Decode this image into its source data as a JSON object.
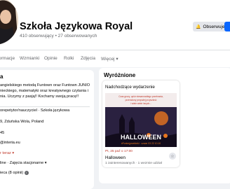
{
  "page": {
    "name": "Szkoła Językowa Royal",
    "followers": "410 obserwujący • 27 obserwowanych"
  },
  "actions": {
    "follow_label": "Obserwujesz"
  },
  "tabs": [
    "ormacje",
    "Wzmianki",
    "Opinie",
    "Rolki",
    "Zdjęcia",
    "Więcej"
  ],
  "intro": {
    "title": "a",
    "lines": [
      "angielskiego metodą Funtown oraz Funtown JUNIOR,",
      "nieckiego, matematyki oraz kreatywnego czytania i",
      "nia. Uczymy z pasją!! Kochamy swoją pracę!!"
    ],
    "items": [
      "orepetytor/nauczyciel · Szkoła językowa",
      "9, Zduńska Wola, Poland",
      "45",
      "@interia.eu",
      "r teraz",
      "line · Zajęcia stacjonarne",
      "ieca (8 opinii)"
    ]
  },
  "featured": {
    "title": "Wyróżnione",
    "card_title": "Nadchodzące wydarzenie",
    "poster_top_text": [
      "Czas grozy, upiór niesamowitego przebrania,",
      "przerażony przyszłej przyszłość",
      "i wiele wiele innych..."
    ],
    "poster_title": "HALLOWEEN",
    "poster_sub": "#Funkejprzebieki · czwar 03 22 10.10",
    "event_date": "Pt, 25 paź o 17:00",
    "event_name": "Halloween",
    "event_stats": "1 zainteresowanych · 1 wezmie udział"
  },
  "colors": {
    "accent": "#0866ff",
    "poster_bg": "#2a2140",
    "poster_orange": "#e8761e",
    "date_red": "#c0392b"
  }
}
